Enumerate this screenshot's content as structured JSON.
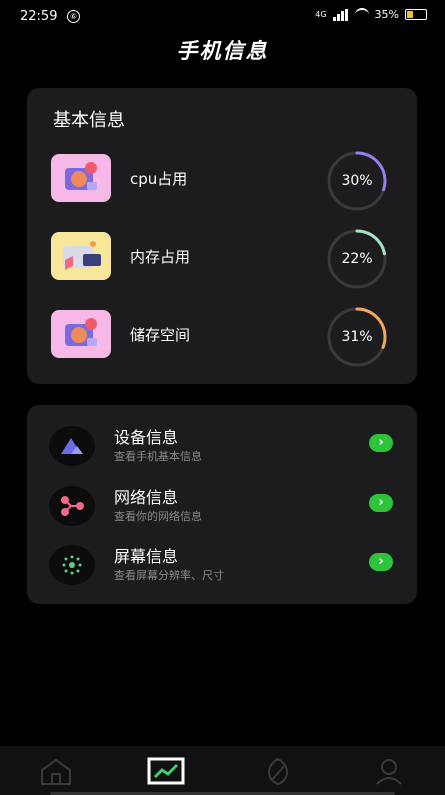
{
  "status": {
    "time": "22:59",
    "notif": "⑥",
    "net": "4G",
    "battery": "35%"
  },
  "title": "手机信息",
  "basic": {
    "title": "基本信息",
    "metrics": [
      {
        "label": "cpu占用",
        "percent": "30%",
        "value": 0.3,
        "color": "#9a7cf0",
        "icon": "cpu-illustration-icon"
      },
      {
        "label": "内存占用",
        "percent": "22%",
        "value": 0.22,
        "color": "#a6e3c0",
        "icon": "memory-illustration-icon"
      },
      {
        "label": "储存空间",
        "percent": "31%",
        "value": 0.31,
        "color": "#f0a860",
        "icon": "storage-illustration-icon"
      }
    ]
  },
  "list": [
    {
      "title": "设备信息",
      "sub": "查看手机基本信息",
      "icon": "triangle-icon"
    },
    {
      "title": "网络信息",
      "sub": "查看你的网络信息",
      "icon": "network-nodes-icon"
    },
    {
      "title": "屏幕信息",
      "sub": "查看屏幕分辨率、尺寸",
      "icon": "screen-dots-icon"
    }
  ],
  "tabs": [
    {
      "name": "home",
      "icon": "home-icon",
      "active": false
    },
    {
      "name": "chart",
      "icon": "chart-icon",
      "active": true
    },
    {
      "name": "leaf",
      "icon": "leaf-icon",
      "active": false
    },
    {
      "name": "profile",
      "icon": "profile-icon",
      "active": false
    }
  ]
}
